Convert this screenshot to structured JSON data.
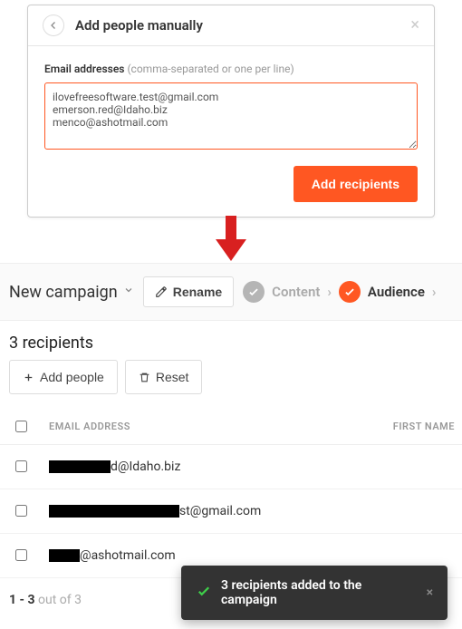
{
  "modal": {
    "title": "Add people manually",
    "email_label": "Email addresses",
    "email_hint": "(comma-separated or one per line)",
    "textarea": "ilovefreesoftware.test@gmail.com\nemerson.red@Idaho.biz\nmenco@ashotmail.com",
    "add_btn": "Add recipients"
  },
  "colors": {
    "accent": "#ff5722"
  },
  "header": {
    "campaign_name": "New campaign",
    "rename_label": "Rename",
    "step_content": "Content",
    "step_audience": "Audience"
  },
  "recipients": {
    "heading": "3 recipients",
    "add_people": "Add people",
    "reset": "Reset",
    "columns": {
      "email": "EMAIL ADDRESS",
      "first": "FIRST NAME"
    },
    "rows": [
      {
        "email_suffix": "d@Idaho.biz",
        "redact_w": 68
      },
      {
        "email_suffix": "st@gmail.com",
        "redact_w": 144
      },
      {
        "email_suffix": "@ashotmail.com",
        "redact_w": 34
      }
    ],
    "pager_bold": "1 - 3",
    "pager_rest": " out of 3"
  },
  "toast": {
    "text": "3 recipients added to the campaign"
  }
}
